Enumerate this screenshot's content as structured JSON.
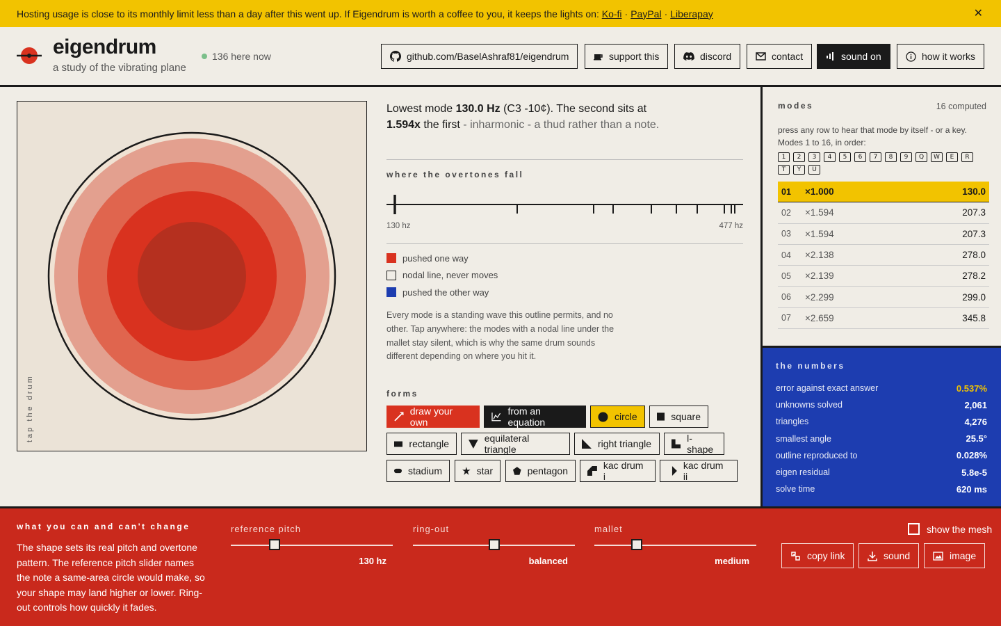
{
  "banner": {
    "message": "Hosting usage is close to its monthly limit less than a day after this went up. If Eigendrum is worth a coffee to you, it keeps the lights on:",
    "links": [
      "Ko-fi",
      "PayPal",
      "Liberapay"
    ],
    "separator": "·",
    "close": "✕"
  },
  "header": {
    "brand": "eigendrum",
    "tagline": "a study of the vibrating plane",
    "online": "136 here now",
    "buttons": {
      "github": "github.com/BaselAshraf81/eigendrum",
      "support": "support this",
      "discord": "discord",
      "contact": "contact",
      "sound": "sound on",
      "how": "how it works"
    }
  },
  "drum": {
    "side_label": "tap the drum"
  },
  "summary": {
    "line1_a": "Lowest mode ",
    "freq": "130.0 Hz",
    "note": " (C3 -10¢). The second sits at",
    "ratio": "1.594x",
    "line2_a": " the first",
    "line2_b": " - inharmonic - a thud rather than a note."
  },
  "overtones": {
    "title": "where the overtones fall",
    "min_label": "130 hz",
    "max_label": "477 hz",
    "range_hz": [
      130,
      477
    ]
  },
  "legend": [
    {
      "label": "pushed one way",
      "color": "#d9321f"
    },
    {
      "label": "nodal line, never moves",
      "color": "#f0ede6"
    },
    {
      "label": "pushed the other way",
      "color": "#1d3db0"
    }
  ],
  "description": "Every mode is a standing wave this outline permits, and no other. Tap anywhere: the modes with a nodal line under the mallet stay silent, which is why the same drum sounds different depending on where you hit it.",
  "forms": {
    "title": "forms",
    "items": {
      "draw": "draw your own",
      "equation": "from an equation",
      "circle": "circle",
      "square": "square",
      "rectangle": "rectangle",
      "equilateral": "equilateral triangle",
      "right": "right triangle",
      "lshape": "l-shape",
      "stadium": "stadium",
      "star": "star",
      "pentagon": "pentagon",
      "kac1": "kac drum i",
      "kac2": "kac drum ii"
    }
  },
  "modes": {
    "title": "modes",
    "count": "16 computed",
    "hint": "press any row to hear that mode by itself - or a key. Modes 1 to 16, in order:",
    "keys": [
      "1",
      "2",
      "3",
      "4",
      "5",
      "6",
      "7",
      "8",
      "9",
      "Q",
      "W",
      "E",
      "R",
      "T",
      "Y",
      "U"
    ],
    "rows": [
      {
        "n": "01",
        "ratio": "×1.000",
        "freq": "130.0"
      },
      {
        "n": "02",
        "ratio": "×1.594",
        "freq": "207.3"
      },
      {
        "n": "03",
        "ratio": "×1.594",
        "freq": "207.3"
      },
      {
        "n": "04",
        "ratio": "×2.138",
        "freq": "278.0"
      },
      {
        "n": "05",
        "ratio": "×2.139",
        "freq": "278.2"
      },
      {
        "n": "06",
        "ratio": "×2.299",
        "freq": "299.0"
      },
      {
        "n": "07",
        "ratio": "×2.659",
        "freq": "345.8"
      }
    ]
  },
  "numbers": {
    "title": "the numbers",
    "rows": [
      {
        "label": "error against exact answer",
        "value": "0.537%"
      },
      {
        "label": "unknowns solved",
        "value": "2,061"
      },
      {
        "label": "triangles",
        "value": "4,276"
      },
      {
        "label": "smallest angle",
        "value": "25.5°"
      },
      {
        "label": "outline reproduced to",
        "value": "0.028%"
      },
      {
        "label": "eigen residual",
        "value": "5.8e-5"
      },
      {
        "label": "solve time",
        "value": "620 ms"
      }
    ]
  },
  "bottom": {
    "title": "what you can and can't change",
    "text": "The shape sets its real pitch and overtone pattern. The reference pitch slider names the note a same-area circle would make, so your shape may land higher or lower. Ring-out controls how quickly it fades.",
    "sliders": {
      "pitch": {
        "label": "reference pitch",
        "value": "130 hz",
        "level": 0.27
      },
      "ring": {
        "label": "ring-out",
        "value": "balanced",
        "level": 0.5
      },
      "mallet": {
        "label": "mallet",
        "value": "medium",
        "level": 0.26
      }
    },
    "mesh": "show the mesh",
    "buttons": {
      "copy": "copy link",
      "sound": "sound",
      "image": "image"
    }
  }
}
